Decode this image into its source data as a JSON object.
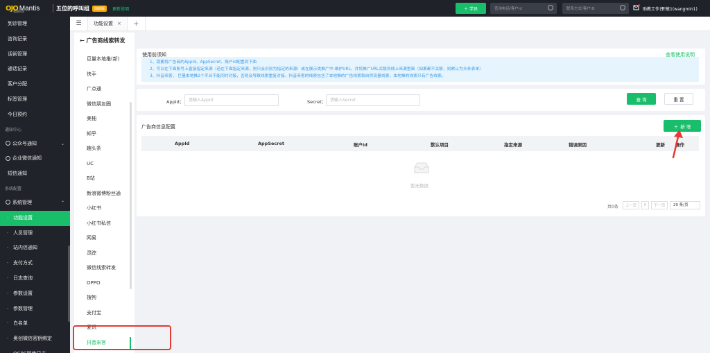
{
  "topbar": {
    "logo_mark": "OJO",
    "logo_text": "Mantis",
    "logo_sub": "螳螂科技",
    "org_name": "五位的呼叫组",
    "badge": "旗舰版",
    "update_link": "更新说明",
    "student_button": "学员",
    "search_phone_placeholder": "查询电话/客户id",
    "search_contact_placeholder": "联系方式/客户ID",
    "workbench": "助教工作台",
    "user": "王敏1(wangmin1)"
  },
  "leftnav": {
    "items": [
      {
        "label": "到诊管理",
        "kind": "item"
      },
      {
        "label": "咨询记录",
        "kind": "item"
      },
      {
        "label": "话術管理",
        "kind": "item"
      },
      {
        "label": "通话记录",
        "kind": "item"
      },
      {
        "label": "客户分配",
        "kind": "item"
      },
      {
        "label": "标签管理",
        "kind": "item"
      },
      {
        "label": "今日预约",
        "kind": "item"
      },
      {
        "label": "通知中心",
        "kind": "section"
      },
      {
        "label": "公众号通知",
        "kind": "parent",
        "chevron": "⌄"
      },
      {
        "label": "企业微信通知",
        "kind": "parent"
      },
      {
        "label": "短信通知",
        "kind": "item"
      },
      {
        "label": "系统配置",
        "kind": "section"
      },
      {
        "label": "系统管理",
        "kind": "parent",
        "chevron": "⌃"
      },
      {
        "label": "功能设置",
        "kind": "sub",
        "active": true
      },
      {
        "label": "人员管理",
        "kind": "sub"
      },
      {
        "label": "站内信通知",
        "kind": "sub"
      },
      {
        "label": "支付方式",
        "kind": "sub"
      },
      {
        "label": "日志查询",
        "kind": "sub"
      },
      {
        "label": "参数设置",
        "kind": "sub"
      },
      {
        "label": "参数管理",
        "kind": "sub"
      },
      {
        "label": "白名单",
        "kind": "sub"
      },
      {
        "label": "奥创微信密钥绑定",
        "kind": "sub"
      },
      {
        "label": "OCPC回传日志",
        "kind": "sub"
      }
    ]
  },
  "tabs": {
    "items": [
      {
        "label": "功能设置",
        "close": "×"
      }
    ],
    "add": "+"
  },
  "subnav": {
    "title": "广告商线索转发",
    "back": "←",
    "items": [
      "巨量本地推(新)",
      "快手",
      "广点通",
      "微信朋友圈",
      "美柚",
      "知乎",
      "趣头条",
      "UC",
      "B站",
      "新浪微博粉丝通",
      "小红书",
      "小红书私信",
      "网易",
      "灵踪",
      "微信线索转发",
      "OPPO",
      "搜狗",
      "支付宝",
      "爱讯",
      "抖音来客"
    ],
    "active_index": 19
  },
  "notice": {
    "title": "使用前须知",
    "help_link": "查看使用说明",
    "lines": [
      "1、需要将广告商的AppId、AppSecret、账户id配置到下面",
      "2、可以在下面账号上直接指定来源（若在下面指定来源，则只会识别为指定的来源）或在展示类推广中-维护URL，并将推广URL关联到线上来源里面（如果都不关联，则默认为头条表单）",
      "3、抖音来客， 巨量本地推2个平台不能同时对接，否则会导致线索重复对接，抖音来客的线索包含了本地推的广告线索和自然流量线索，本地推的线索只有广告线索。"
    ]
  },
  "form": {
    "appid_label": "AppId：",
    "appid_placeholder": "请输入AppId",
    "secret_label": "Secret：",
    "secret_placeholder": "请输入Secret",
    "query": "查 询",
    "reset": "重 置"
  },
  "table": {
    "title": "广告商信息配置",
    "add": "新 增",
    "columns": [
      "AppId",
      "AppSecret",
      "账户id",
      "默认项目",
      "指定来源",
      "错误原因",
      "更新",
      "操作"
    ],
    "empty": "暂无数据"
  },
  "pager": {
    "total": "共0条",
    "prev": "上一页",
    "page": "0",
    "next": "下一页",
    "size": "20 条/页"
  },
  "colors": {
    "accent": "#19be6b",
    "nav_bg": "#20242a",
    "topbar_bg": "#1f2329",
    "notice_bg": "#e6f4fd",
    "annotation": "#e53935"
  }
}
